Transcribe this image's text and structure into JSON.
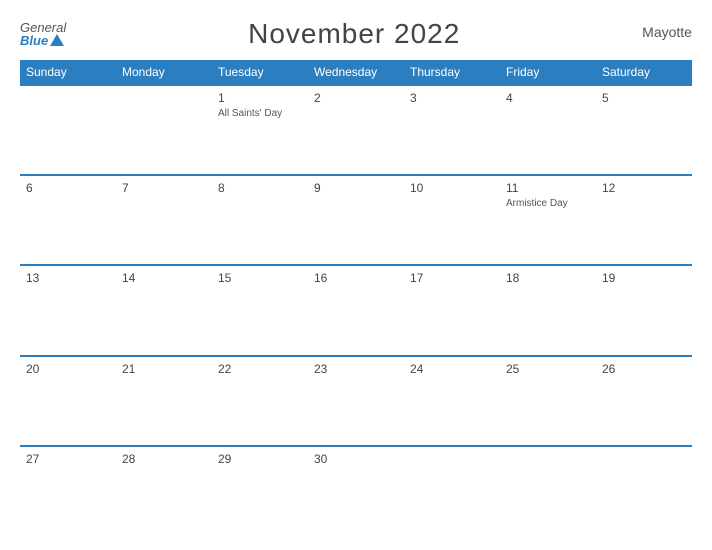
{
  "header": {
    "logo_general": "General",
    "logo_blue": "Blue",
    "title": "November 2022",
    "region": "Mayotte"
  },
  "weekdays": [
    "Sunday",
    "Monday",
    "Tuesday",
    "Wednesday",
    "Thursday",
    "Friday",
    "Saturday"
  ],
  "weeks": [
    [
      {
        "day": "",
        "holiday": "",
        "empty": true
      },
      {
        "day": "",
        "holiday": "",
        "empty": true
      },
      {
        "day": "1",
        "holiday": "All Saints' Day",
        "empty": false
      },
      {
        "day": "2",
        "holiday": "",
        "empty": false
      },
      {
        "day": "3",
        "holiday": "",
        "empty": false
      },
      {
        "day": "4",
        "holiday": "",
        "empty": false
      },
      {
        "day": "5",
        "holiday": "",
        "empty": false
      }
    ],
    [
      {
        "day": "6",
        "holiday": "",
        "empty": false
      },
      {
        "day": "7",
        "holiday": "",
        "empty": false
      },
      {
        "day": "8",
        "holiday": "",
        "empty": false
      },
      {
        "day": "9",
        "holiday": "",
        "empty": false
      },
      {
        "day": "10",
        "holiday": "",
        "empty": false
      },
      {
        "day": "11",
        "holiday": "Armistice Day",
        "empty": false
      },
      {
        "day": "12",
        "holiday": "",
        "empty": false
      }
    ],
    [
      {
        "day": "13",
        "holiday": "",
        "empty": false
      },
      {
        "day": "14",
        "holiday": "",
        "empty": false
      },
      {
        "day": "15",
        "holiday": "",
        "empty": false
      },
      {
        "day": "16",
        "holiday": "",
        "empty": false
      },
      {
        "day": "17",
        "holiday": "",
        "empty": false
      },
      {
        "day": "18",
        "holiday": "",
        "empty": false
      },
      {
        "day": "19",
        "holiday": "",
        "empty": false
      }
    ],
    [
      {
        "day": "20",
        "holiday": "",
        "empty": false
      },
      {
        "day": "21",
        "holiday": "",
        "empty": false
      },
      {
        "day": "22",
        "holiday": "",
        "empty": false
      },
      {
        "day": "23",
        "holiday": "",
        "empty": false
      },
      {
        "day": "24",
        "holiday": "",
        "empty": false
      },
      {
        "day": "25",
        "holiday": "",
        "empty": false
      },
      {
        "day": "26",
        "holiday": "",
        "empty": false
      }
    ],
    [
      {
        "day": "27",
        "holiday": "",
        "empty": false
      },
      {
        "day": "28",
        "holiday": "",
        "empty": false
      },
      {
        "day": "29",
        "holiday": "",
        "empty": false
      },
      {
        "day": "30",
        "holiday": "",
        "empty": false
      },
      {
        "day": "",
        "holiday": "",
        "empty": true
      },
      {
        "day": "",
        "holiday": "",
        "empty": true
      },
      {
        "day": "",
        "holiday": "",
        "empty": true
      }
    ]
  ]
}
